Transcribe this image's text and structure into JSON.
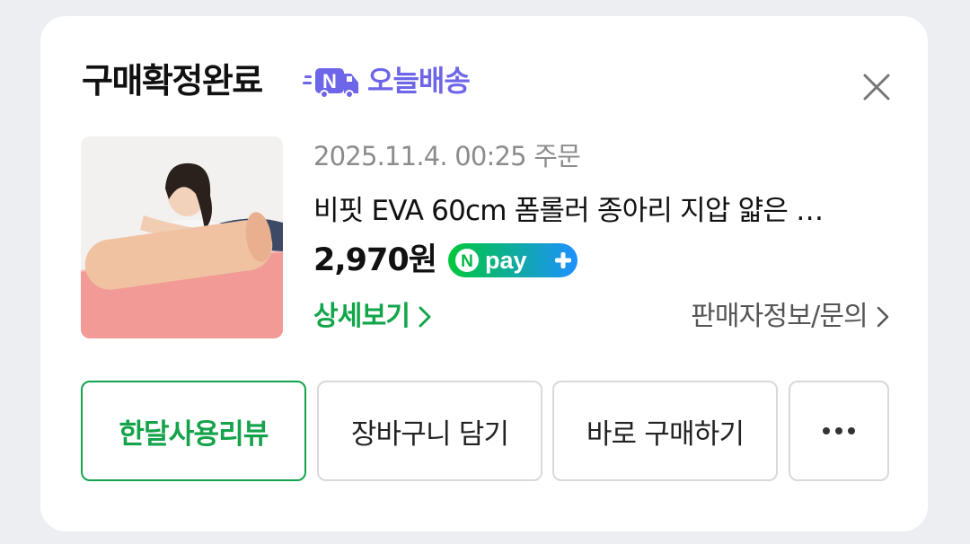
{
  "order": {
    "status_title": "구매확정완료",
    "delivery_badge": "오늘배송",
    "date": "2025.11.4. 00:25 주문",
    "product_name": "비핏 EVA 60cm 폼롤러 종아리 지압 얇은 …",
    "price": "2,970원",
    "payment_badge": "pay",
    "detail_link": "상세보기",
    "seller_link": "판매자정보/문의"
  },
  "actions": {
    "review": "한달사용리뷰",
    "cart": "장바구니 담기",
    "buy": "바로 구매하기"
  },
  "icons": {
    "truck": "n-delivery-truck-icon",
    "close": "close-icon",
    "chevron": "chevron-right-icon",
    "more": "more-dots-icon"
  },
  "colors": {
    "brand_green": "#14a34a",
    "delivery_purple": "#6e66e8",
    "npay_start": "#00c73c",
    "npay_end": "#1e90ff"
  }
}
